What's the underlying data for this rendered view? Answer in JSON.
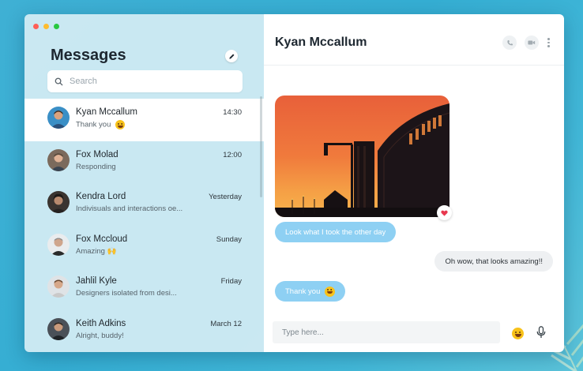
{
  "window": {
    "controls": [
      "close",
      "minimize",
      "maximize"
    ]
  },
  "sidebar": {
    "title": "Messages",
    "compose_icon": "pencil-icon",
    "search": {
      "placeholder": "Search",
      "value": "",
      "icon": "search-icon"
    },
    "conversations": [
      {
        "name": "Kyan Mccallum",
        "time": "14:30",
        "preview": "Thank you",
        "preview_emoji": "grinning-face",
        "active": true
      },
      {
        "name": "Fox Molad",
        "time": "12:00",
        "preview": "Responding",
        "active": false
      },
      {
        "name": "Kendra Lord",
        "time": "Yesterday",
        "preview": "Indivisuals and interactions oe...",
        "active": false
      },
      {
        "name": "Fox Mccloud",
        "time": "Sunday",
        "preview": "Amazing 🙌",
        "active": false
      },
      {
        "name": "Jahlil Kyle",
        "time": "Friday",
        "preview": "Designers isolated from desi...",
        "active": false
      },
      {
        "name": "Keith Adkins",
        "time": "March 12",
        "preview": "Alright, buddy!",
        "active": false
      }
    ]
  },
  "chat": {
    "contact_name": "Kyan Mccallum",
    "header_actions": [
      "phone-icon",
      "video-camera-icon",
      "more-vertical-icon"
    ],
    "messages": [
      {
        "type": "image",
        "direction": "incoming",
        "subject": "sunset stadium silhouette photo",
        "reaction": "heart-icon"
      },
      {
        "type": "text",
        "direction": "incoming",
        "text": "Look what I took the other day"
      },
      {
        "type": "text",
        "direction": "outgoing",
        "text": "Oh wow, that looks amazing!!"
      },
      {
        "type": "text",
        "direction": "incoming",
        "text": "Thank you",
        "emoji": "grinning-face"
      }
    ],
    "composer": {
      "placeholder": "Type here...",
      "value": ""
    },
    "composer_actions": [
      "emoji-icon",
      "microphone-icon"
    ]
  },
  "colors": {
    "background": "#3fb0d4",
    "sidebar": "#d6edf4",
    "incoming_bubble": "#8ed0f3",
    "outgoing_bubble": "#eef0f2",
    "heart": "#e8384f"
  }
}
